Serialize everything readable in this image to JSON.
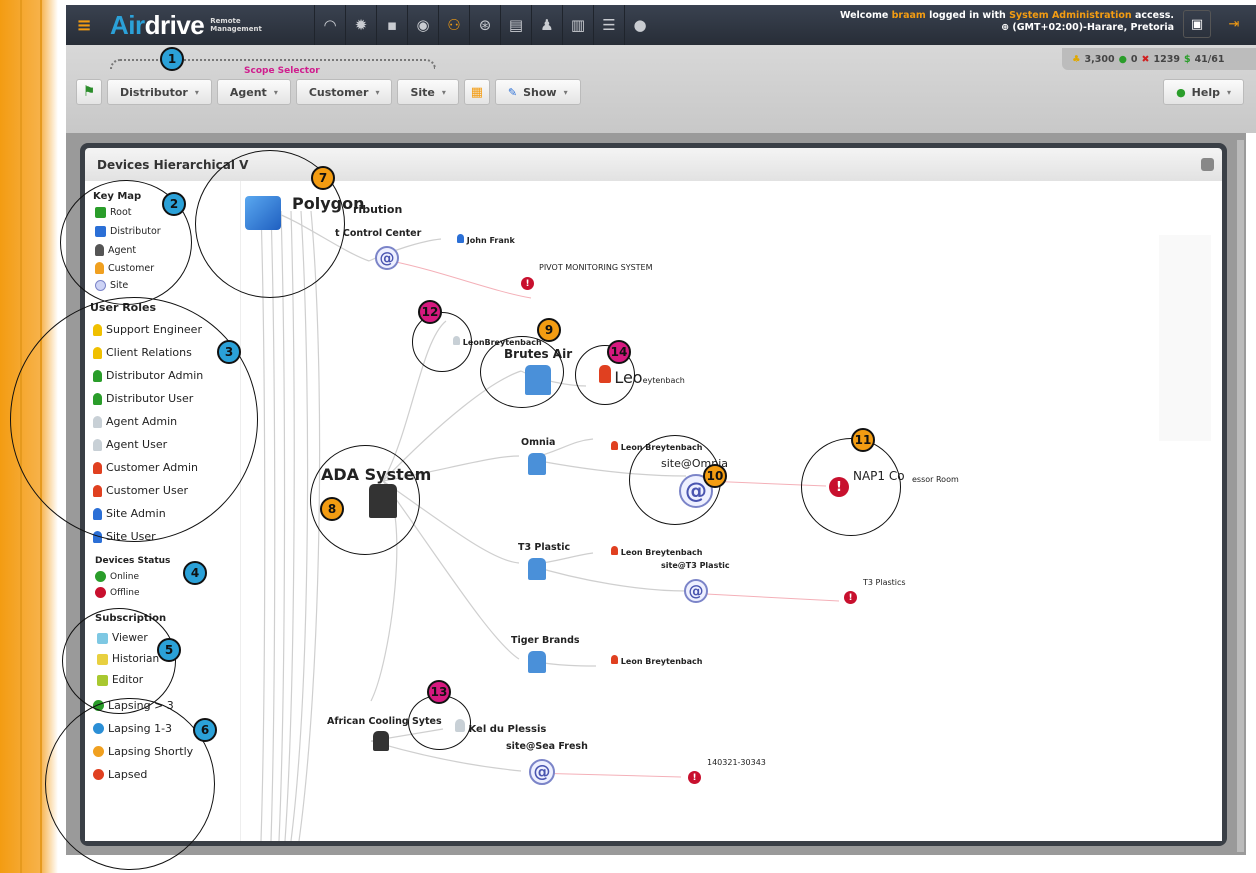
{
  "app": {
    "brand_air": "Air",
    "brand_drive": "drive",
    "brand_tag_line1": "Remote",
    "brand_tag_line2": "Management",
    "welcome_prefix": "Welcome ",
    "user": "braam",
    "welcome_mid": " logged in with ",
    "access_level": "System Administration",
    "welcome_suffix": " access.",
    "timezone": "(GMT+02:00)-Harare, Pretoria"
  },
  "nav_icons": [
    "dashboard-icon",
    "settings-icon",
    "grid-icon",
    "eye-icon",
    "hierarchy-icon",
    "support-icon",
    "document-icon",
    "users-icon",
    "book-icon",
    "list-icon",
    "chat-icon"
  ],
  "stats": {
    "total": "3,300",
    "online": "0",
    "offline": "1239",
    "ratio": "41/61"
  },
  "scope": {
    "label": "Scope Selector"
  },
  "filters": {
    "distributor": "Distributor",
    "agent": "Agent",
    "customer": "Customer",
    "site": "Site",
    "show": "Show",
    "help": "Help"
  },
  "panel": {
    "title": "Devices Hierarchical V"
  },
  "legend": {
    "keymap_title": "Key Map",
    "keymap": [
      "Root",
      "Distributor",
      "Agent",
      "Customer",
      "Site"
    ],
    "roles_title": "User Roles",
    "roles": [
      "Support Engineer",
      "Client Relations",
      "Distributor Admin",
      "Distributor User",
      "Agent Admin",
      "Agent User",
      "Customer Admin",
      "Customer User",
      "Site Admin",
      "Site User"
    ],
    "status_title": "Devices Status",
    "status": [
      "Online",
      "Offline"
    ],
    "subscription_title": "Subscription",
    "subscription": [
      "Viewer",
      "Historian",
      "Editor"
    ],
    "lapsing": [
      "Lapsing > 3",
      "Lapsing 1-3",
      "Lapsing Shortly",
      "Lapsed"
    ]
  },
  "graph": {
    "root": "Polygon",
    "root_suffix": "ribution",
    "control_center": "t Control Center",
    "john": "John Frank",
    "pivot": "PIVOT MONITORING SYSTEM",
    "leon_br": "LeonBreytenbach",
    "brutes": "Brutes Air",
    "leo_big": "Leo",
    "leo_rest": "eytenbach",
    "omnia": "Omnia",
    "leon1": "Leon Breytenbach",
    "site_omnia": "site@Omnia",
    "nap1": "NAP1 Co",
    "nap1_rest": "essor Room",
    "scada": "ADA System",
    "t3": "T3 Plastic",
    "leon2": "Leon Breytenbach",
    "site_t3": "site@T3 Plastic",
    "t3plastics": "T3 Plastics",
    "tiger": "Tiger Brands",
    "leon3": "Leon Breytenbach",
    "african": "African Cooling Sytes",
    "kel": "Kel du Plessis",
    "site_sea": "site@Sea Fresh",
    "device_id": "140321-30343",
    "at_symbol": "@",
    "alarm_symbol": "!"
  },
  "badges": [
    "1",
    "2",
    "3",
    "4",
    "5",
    "6",
    "7",
    "8",
    "9",
    "10",
    "11",
    "12",
    "13",
    "14"
  ]
}
